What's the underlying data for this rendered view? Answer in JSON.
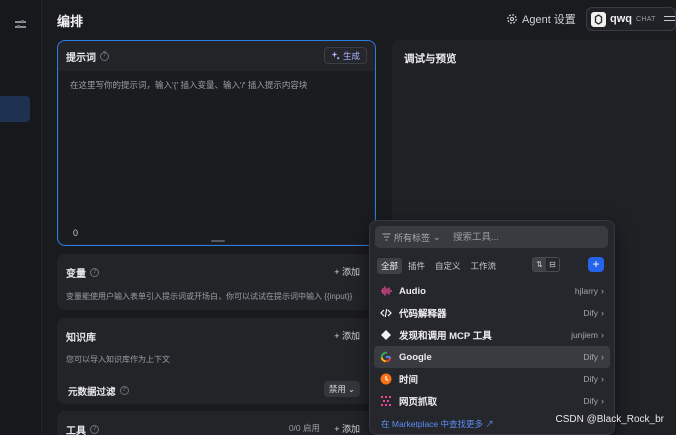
{
  "header": {
    "title": "编排",
    "agent_settings": "Agent 设置",
    "model_name": "qwq",
    "model_mode": "CHAT"
  },
  "prompt": {
    "label": "提示词",
    "generate": "生成",
    "placeholder": "在这里写你的提示词，输入'{' 插入变量、输入'/' 插入提示内容块",
    "char_count": "0"
  },
  "variables": {
    "title": "变量",
    "add": "+ 添加",
    "desc": "变量能使用户输入表单引入提示词或开场白，你可以试试在提示词中输入 {{input}}"
  },
  "knowledge": {
    "title": "知识库",
    "add": "+ 添加",
    "desc": "您可以导入知识库作为上下文",
    "metadata_filter": "元数据过滤",
    "metadata_state": "禁用"
  },
  "tools": {
    "title": "工具",
    "count": "0/0 启用",
    "add": "+ 添加"
  },
  "debug": {
    "title": "调试与预览"
  },
  "tool_picker": {
    "filter": "所有标签",
    "search_placeholder": "搜索工具...",
    "tabs": [
      "全部",
      "插件",
      "自定义",
      "工作流"
    ],
    "items": [
      {
        "name": "Audio",
        "author": "hjlarry"
      },
      {
        "name": "代码解释器",
        "author": "Dify"
      },
      {
        "name": "发现和调用 MCP 工具",
        "author": "junjiem"
      },
      {
        "name": "Google",
        "author": "Dify"
      },
      {
        "name": "时间",
        "author": "Dify"
      },
      {
        "name": "网页抓取",
        "author": "Dify"
      }
    ],
    "marketplace_link": "在 Marketplace 中查找更多 ↗"
  },
  "watermark": "CSDN @Black_Rock_br",
  "colors": {
    "accent": "#2f7ce3",
    "primary_button": "#2563eb",
    "link": "#5b8ff5"
  }
}
